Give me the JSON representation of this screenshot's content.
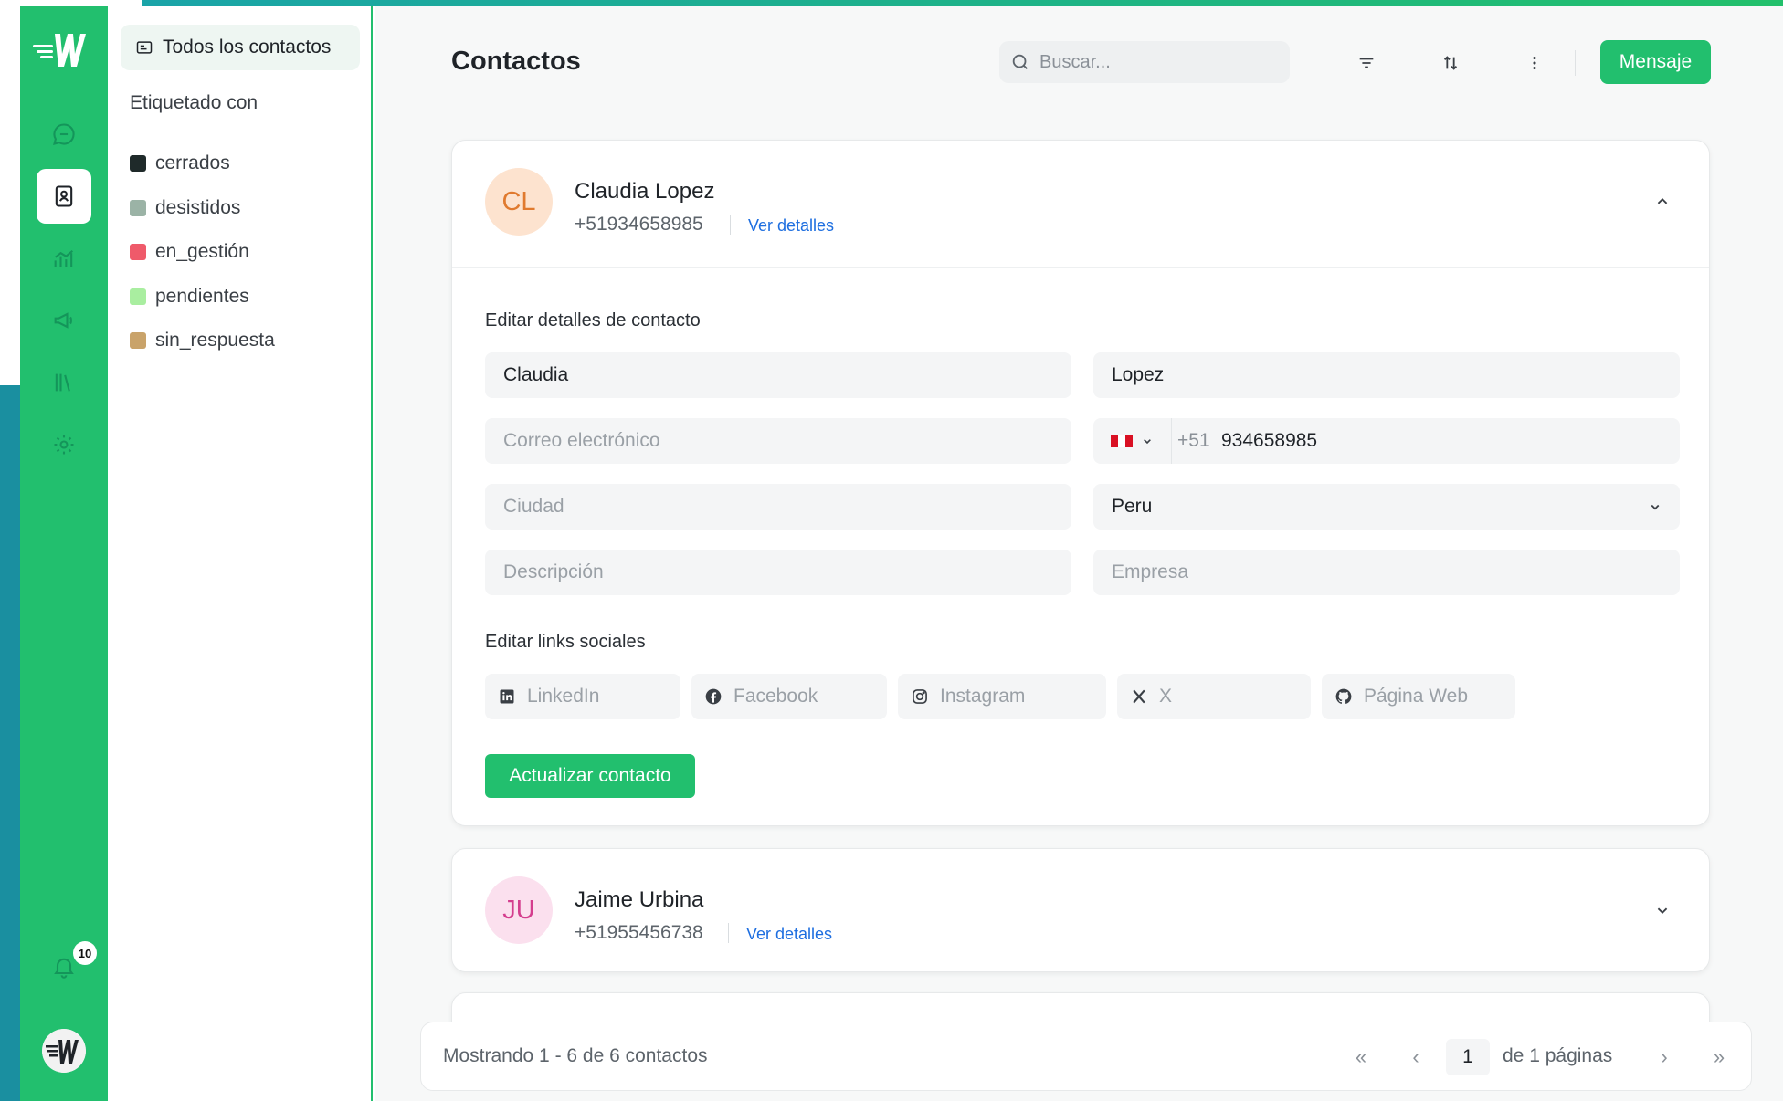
{
  "sidebar": {
    "notification_count": "10"
  },
  "tags": {
    "all_contacts": "Todos los contactos",
    "title": "Etiquetado con",
    "items": [
      {
        "label": "cerrados",
        "color": "#1f2a2a"
      },
      {
        "label": "desistidos",
        "color": "#9bb3a6"
      },
      {
        "label": "en_gestión",
        "color": "#ef5a6a"
      },
      {
        "label": "pendientes",
        "color": "#a9eea0"
      },
      {
        "label": "sin_respuesta",
        "color": "#c9a36a"
      }
    ]
  },
  "header": {
    "title": "Contactos",
    "search_placeholder": "Buscar...",
    "message_button": "Mensaje"
  },
  "contacts": [
    {
      "initials": "CL",
      "name": "Claudia Lopez",
      "phone": "+51934658985",
      "details_link": "Ver detalles",
      "avatar_bg": "#fde3cf",
      "avatar_fg": "#e07a2f"
    },
    {
      "initials": "JU",
      "name": "Jaime Urbina",
      "phone": "+51955456738",
      "details_link": "Ver detalles",
      "avatar_bg": "#fbe0ee",
      "avatar_fg": "#d43d8e"
    }
  ],
  "edit_form": {
    "title": "Editar detalles de contacto",
    "first_name": "Claudia",
    "last_name": "Lopez",
    "email_placeholder": "Correo electrónico",
    "phone_prefix": "+51",
    "phone_number": "934658985",
    "city_placeholder": "Ciudad",
    "country": "Peru",
    "description_placeholder": "Descripción",
    "company_placeholder": "Empresa",
    "social_title": "Editar links sociales",
    "social": {
      "linkedin": "LinkedIn",
      "facebook": "Facebook",
      "instagram": "Instagram",
      "x": "X",
      "website": "Página Web"
    },
    "update_button": "Actualizar contacto"
  },
  "footer": {
    "showing": "Mostrando 1 - 6 de 6 contactos",
    "first": "«",
    "prev": "‹",
    "page": "1",
    "of_pages": "de 1 páginas",
    "next": "›",
    "last": "»"
  },
  "colors": {
    "brand_green": "#22bf6e",
    "link_blue": "#1d6ee0"
  }
}
